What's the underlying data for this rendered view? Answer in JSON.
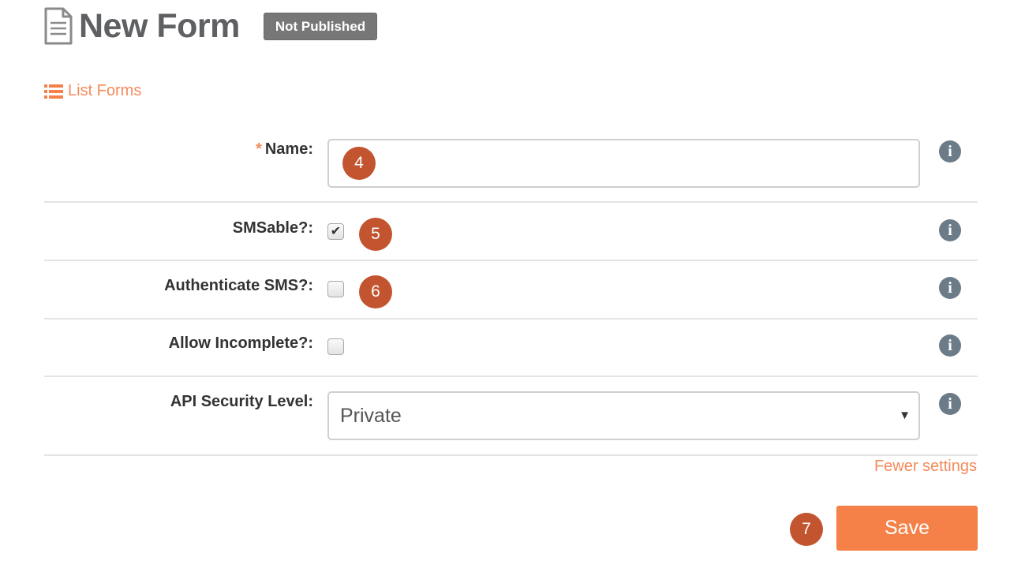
{
  "header": {
    "title": "New Form",
    "status_badge": "Not Published",
    "icon": "document-icon"
  },
  "nav": {
    "list_forms_label": "List Forms",
    "list_icon": "list-icon"
  },
  "form": {
    "name": {
      "required_marker": "*",
      "label": "Name:",
      "value": ""
    },
    "smsable": {
      "label": "SMSable?:",
      "checked": true
    },
    "authenticate_sms": {
      "label": "Authenticate SMS?:",
      "checked": false
    },
    "allow_incomplete": {
      "label": "Allow Incomplete?:",
      "checked": false
    },
    "api_security_level": {
      "label": "API Security Level:",
      "selected": "Private"
    },
    "info_glyph": "i",
    "fewer_settings_label": "Fewer settings",
    "save_label": "Save"
  },
  "annotations": {
    "step_4": "4",
    "step_5": "5",
    "step_6": "6",
    "step_7": "7"
  },
  "colors": {
    "accent": "#f58148",
    "badge": "#777777",
    "marker": "#c25430",
    "info": "#6c7b88"
  }
}
